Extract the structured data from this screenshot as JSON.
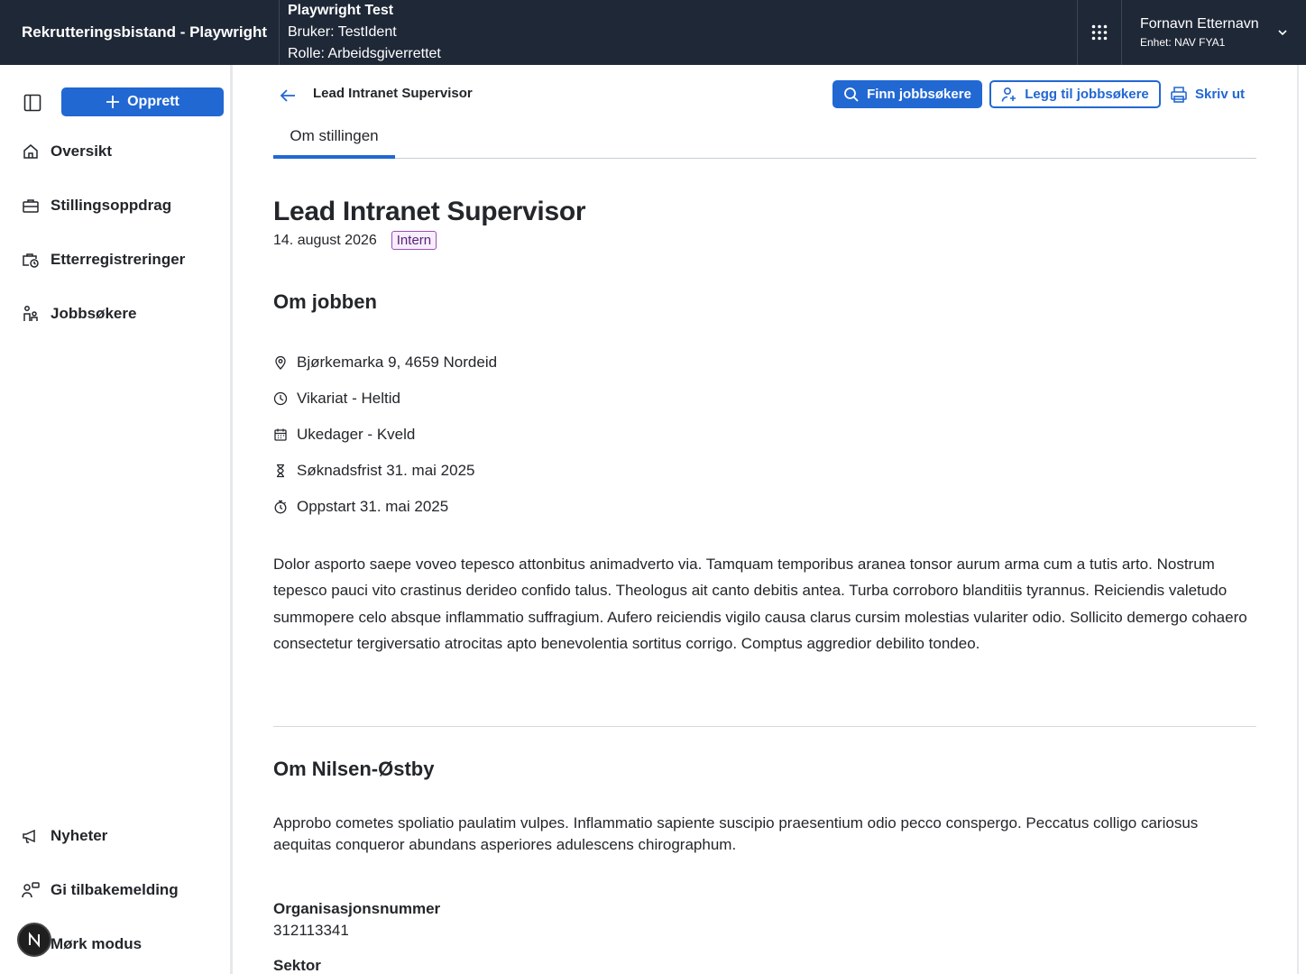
{
  "header": {
    "app_title": "Rekrutteringsbistand - Playwright",
    "env_title": "Playwright Test",
    "env_user": "Bruker: TestIdent",
    "env_role": "Rolle: Arbeidsgiverrettet",
    "user_name": "Fornavn Etternavn",
    "user_unit": "Enhet: NAV FYA1"
  },
  "sidebar": {
    "create_label": "Opprett",
    "items": [
      {
        "label": "Oversikt",
        "icon": "house-icon"
      },
      {
        "label": "Stillingsoppdrag",
        "icon": "briefcase-icon"
      },
      {
        "label": "Etterregistreringer",
        "icon": "briefcase-clock-icon"
      },
      {
        "label": "Jobbsøkere",
        "icon": "people-icon"
      }
    ],
    "bottom_items": [
      {
        "label": "Nyheter",
        "icon": "megaphone-icon"
      },
      {
        "label": "Gi tilbakemelding",
        "icon": "feedback-icon"
      },
      {
        "label": "Mørk modus",
        "icon": "moon-icon"
      }
    ]
  },
  "toolbar": {
    "crumb_title": "Lead Intranet Supervisor",
    "find_label": "Finn jobbsøkere",
    "add_label": "Legg til jobbsøkere",
    "print_label": "Skriv ut"
  },
  "tabs": [
    {
      "label": "Om stillingen",
      "active": true
    }
  ],
  "job": {
    "title": "Lead Intranet Supervisor",
    "date": "14. august 2026",
    "tag": "Intern",
    "section_title": "Om jobben",
    "facts": [
      {
        "icon": "location-pin-icon",
        "text": "Bjørkemarka 9, 4659 Nordeid"
      },
      {
        "icon": "clock-icon",
        "text": "Vikariat - Heltid"
      },
      {
        "icon": "calendar-icon",
        "text": "Ukedager - Kveld"
      },
      {
        "icon": "hourglass-icon",
        "text": "Søknadsfrist 31. mai 2025"
      },
      {
        "icon": "stopwatch-icon",
        "text": "Oppstart 31. mai 2025"
      }
    ],
    "description": "Dolor asporto saepe voveo tepesco attonbitus animadverto via. Tamquam temporibus aranea tonsor aurum arma cum a tutis arto. Nostrum tepesco pauci vito crastinus derideo confido talus. Theologus ait canto debitis antea. Turba corroboro blanditiis tyrannus. Reiciendis valetudo summopere celo absque inflammatio suffragium. Aufero reiciendis vigilo causa clarus cursim molestias vulariter odio. Sollicito demergo cohaero consectetur tergiversatio atrocitas apto benevolentia sortitus corrigo. Comptus aggredior debilito tondeo."
  },
  "employer": {
    "section_title": "Om Nilsen-Østby",
    "description": "Approbo cometes spoliatio paulatim vulpes. Inflammatio sapiente suscipio praesentium odio pecco conspergo. Peccatus colligo cariosus aequitas conqueror abundans asperiores adulescens chirographum.",
    "org_label": "Organisasjonsnummer",
    "org_value": "312113341",
    "sector_label": "Sektor"
  },
  "colors": {
    "header_bg": "#1f2837",
    "accent": "#2168d3",
    "tag_border": "#9a4fb9"
  }
}
